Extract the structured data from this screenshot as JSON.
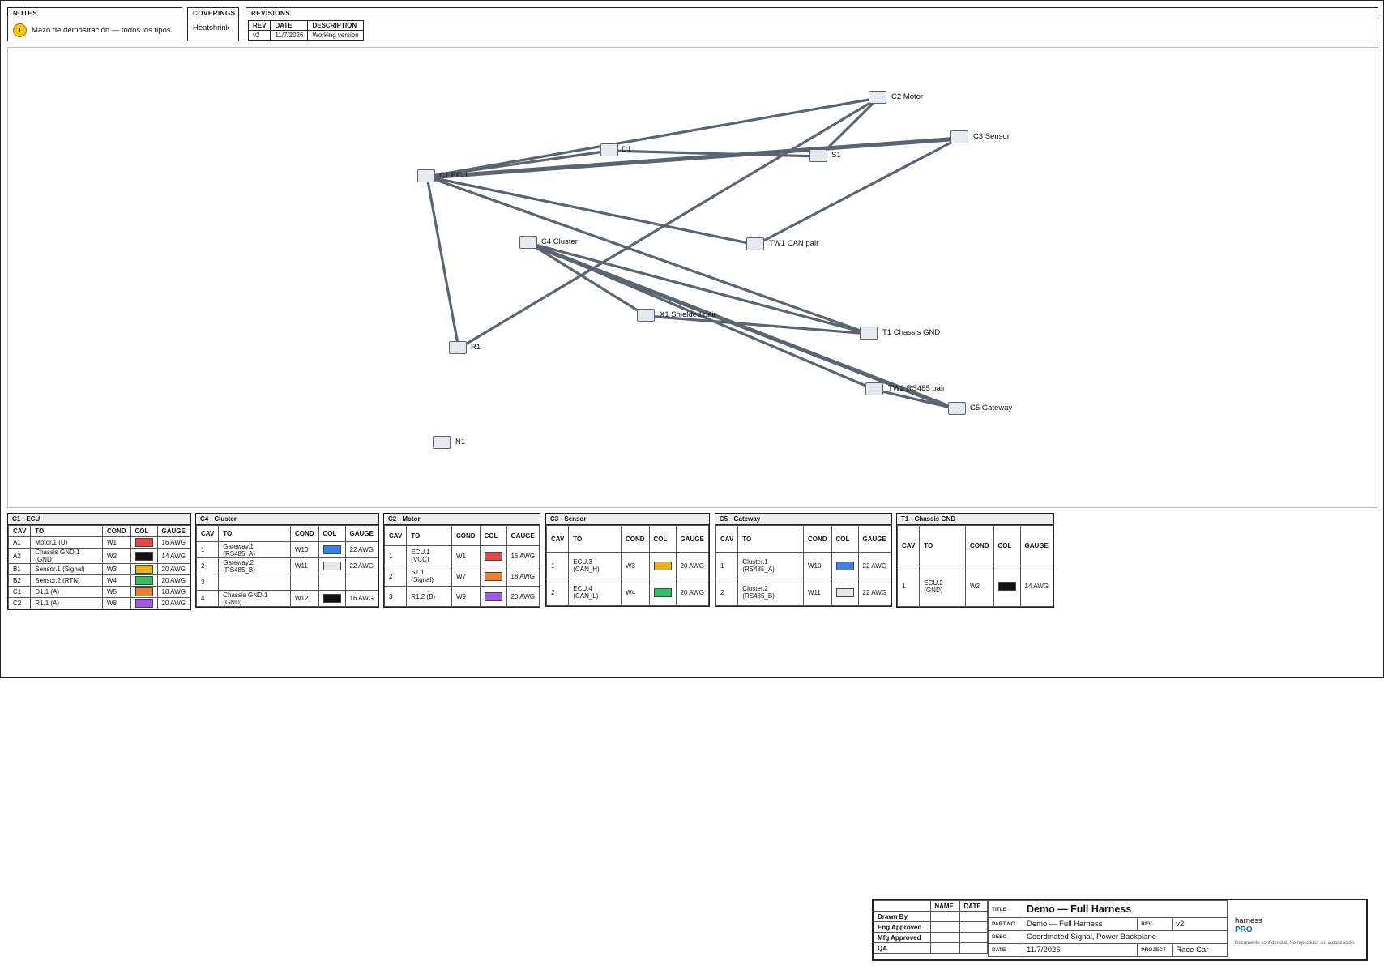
{
  "notes": {
    "title": "NOTES",
    "items": [
      {
        "num": "1",
        "text": "Mazo de demostración — todos los tipos"
      }
    ]
  },
  "coverings": {
    "title": "COVERINGS",
    "value": "Heatshrink"
  },
  "revisions": {
    "title": "REVISIONS",
    "headers": [
      "REV",
      "DATE",
      "DESCRIPTION"
    ],
    "rows": [
      [
        "v2",
        "11/7/2026",
        "Working version"
      ]
    ]
  },
  "diagram": {
    "wire_color": "#5b6470",
    "nodes": {
      "ecu": "C1 ECU",
      "motor": "C2 Motor",
      "sensor": "C3 Sensor",
      "d1": "D1",
      "s1": "S1",
      "cluster": "C4 Cluster",
      "tw1": "TW1 CAN pair",
      "x1": "X1 Shielded pair",
      "chassis": "T1 Chassis GND",
      "r1": "R1",
      "tw2": "TW2 RS485 pair",
      "gateway": "C5 Gateway",
      "n1": "N1"
    }
  },
  "connector_tables": [
    {
      "title": "C1 · ECU",
      "headers": [
        "CAV",
        "TO",
        "COND",
        "COL",
        "GAUGE"
      ],
      "rows": [
        {
          "cav": "A1",
          "to": "Motor.1 (U)",
          "cond": "W1",
          "color": "#e04848",
          "gauge": "16 AWG"
        },
        {
          "cav": "A2",
          "to": "Chassis GND.1 (GND)",
          "cond": "W2",
          "color": "#111111",
          "gauge": "14 AWG"
        },
        {
          "cav": "B1",
          "to": "Sensor.1 (Signal)",
          "cond": "W3",
          "color": "#e6b422",
          "gauge": "20 AWG"
        },
        {
          "cav": "B2",
          "to": "Sensor.2 (RTN)",
          "cond": "W4",
          "color": "#2fbf5f",
          "gauge": "20 AWG"
        },
        {
          "cav": "C1",
          "to": "D1.1 (A)",
          "cond": "W5",
          "color": "#f08030",
          "gauge": "18 AWG"
        },
        {
          "cav": "C2",
          "to": "R1.1 (A)",
          "cond": "W8",
          "color": "#a259e8",
          "gauge": "20 AWG"
        }
      ]
    },
    {
      "title": "C4 · Cluster",
      "headers": [
        "CAV",
        "TO",
        "COND",
        "COL",
        "GAUGE"
      ],
      "rows": [
        {
          "cav": "1",
          "to": "Gateway.1 (RS485_A)",
          "cond": "W10",
          "color": "#3b82e8",
          "gauge": "22 AWG"
        },
        {
          "cav": "2",
          "to": "Gateway.2 (RS485_B)",
          "cond": "W11",
          "color": "#e8e8e8",
          "gauge": "22 AWG"
        },
        {
          "cav": "3",
          "to": "",
          "cond": "",
          "color": "",
          "gauge": ""
        },
        {
          "cav": "4",
          "to": "Chassis GND.1 (GND)",
          "cond": "W12",
          "color": "#111111",
          "gauge": "16 AWG"
        }
      ]
    },
    {
      "title": "C2 · Motor",
      "headers": [
        "CAV",
        "TO",
        "COND",
        "COL",
        "GAUGE"
      ],
      "rows": [
        {
          "cav": "1",
          "to": "ECU.1 (VCC)",
          "cond": "W1",
          "color": "#e04848",
          "gauge": "16 AWG"
        },
        {
          "cav": "2",
          "to": "S1.1 (Signal)",
          "cond": "W7",
          "color": "#f08030",
          "gauge": "18 AWG"
        },
        {
          "cav": "3",
          "to": "R1.2 (B)",
          "cond": "W9",
          "color": "#a259e8",
          "gauge": "20 AWG"
        }
      ]
    },
    {
      "title": "C3 · Sensor",
      "headers": [
        "CAV",
        "TO",
        "COND",
        "COL",
        "GAUGE"
      ],
      "rows": [
        {
          "cav": "1",
          "to": "ECU.3 (CAN_H)",
          "cond": "W3",
          "color": "#e6b422",
          "gauge": "20 AWG"
        },
        {
          "cav": "2",
          "to": "ECU.4 (CAN_L)",
          "cond": "W4",
          "color": "#2fbf5f",
          "gauge": "20 AWG"
        }
      ]
    },
    {
      "title": "C5 · Gateway",
      "headers": [
        "CAV",
        "TO",
        "COND",
        "COL",
        "GAUGE"
      ],
      "rows": [
        {
          "cav": "1",
          "to": "Cluster.1 (RS485_A)",
          "cond": "W10",
          "color": "#3b82e8",
          "gauge": "22 AWG"
        },
        {
          "cav": "2",
          "to": "Cluster.2 (RS485_B)",
          "cond": "W11",
          "color": "#e8e8e8",
          "gauge": "22 AWG"
        }
      ]
    },
    {
      "title": "T1 · Chassis GND",
      "headers": [
        "CAV",
        "TO",
        "COND",
        "COL",
        "GAUGE"
      ],
      "rows": [
        {
          "cav": "1",
          "to": "ECU.2 (GND)",
          "cond": "W2",
          "color": "#111111",
          "gauge": "14 AWG"
        }
      ]
    }
  ],
  "title_block": {
    "approvals_headers": [
      "NAME",
      "DATE"
    ],
    "approvals": [
      "Drawn By",
      "Eng Approved",
      "Mfg Approved",
      "QA"
    ],
    "title_key": "TITLE",
    "title": "Demo — Full Harness",
    "partno_key": "PART NO",
    "partno": "Demo — Full Harness",
    "rev_key": "REV",
    "rev": "v2",
    "desc_key": "DESC",
    "desc": "Coordinated Signal, Power Backplane",
    "date_key": "DATE",
    "date": "11/7/2026",
    "project_key": "PROJECT",
    "project": "Race Car",
    "brand_line1": "harness",
    "brand_line2": "PRO",
    "confidential": "Documento confidencial. No reproducir sin autorización."
  }
}
